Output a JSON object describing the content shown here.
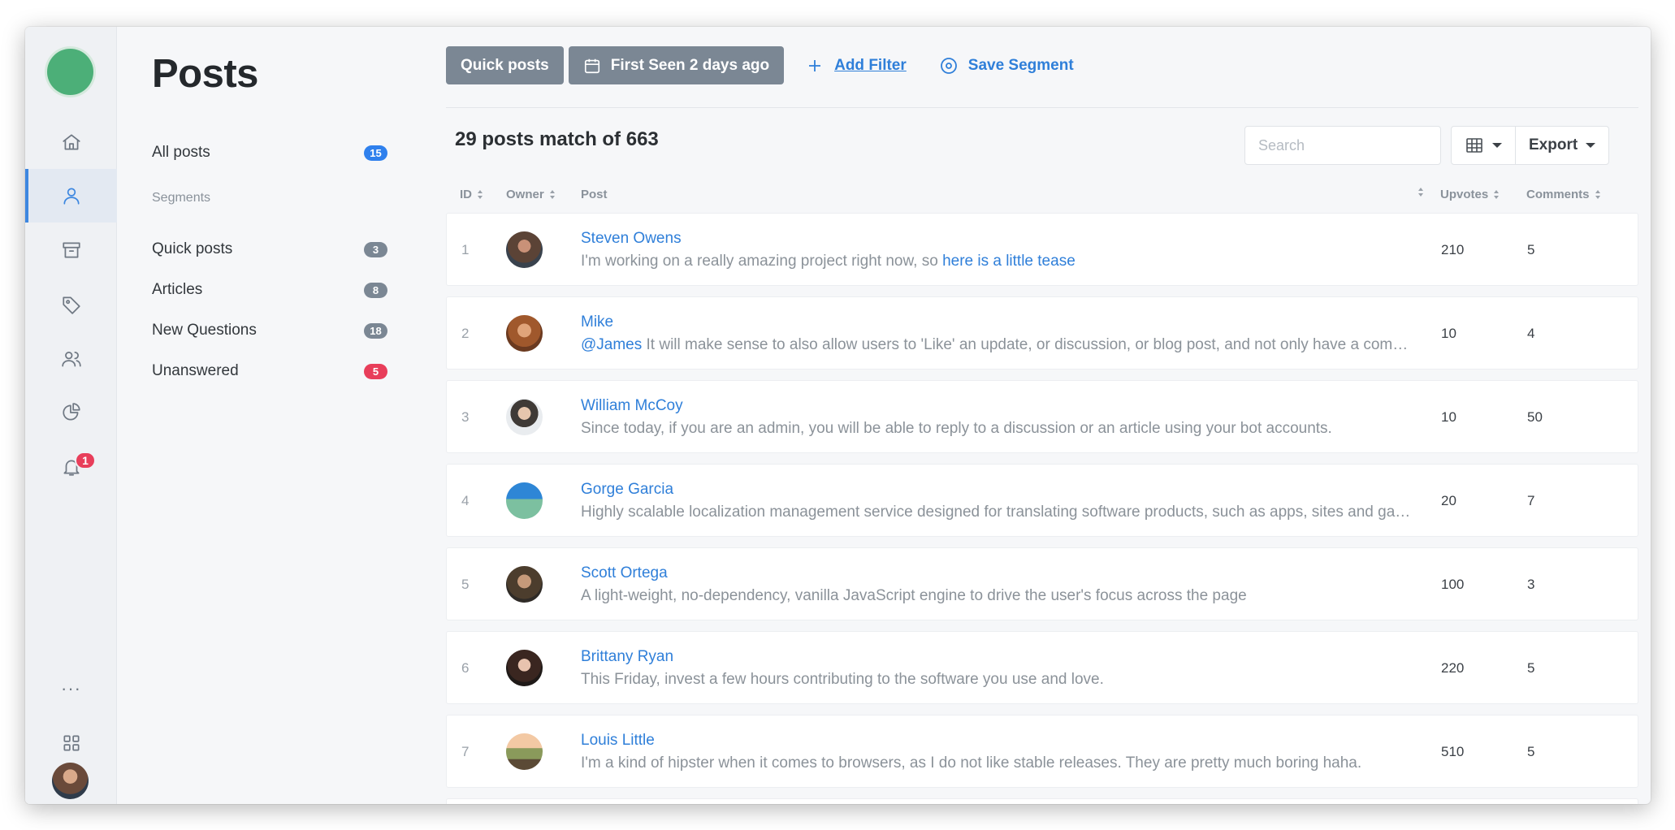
{
  "page": {
    "title": "Posts"
  },
  "segments": {
    "all": {
      "label": "All posts",
      "count": "15",
      "color": "#2f80ed"
    },
    "heading": "Segments",
    "items": [
      {
        "label": "Quick posts",
        "count": "3",
        "color": "#7b8794"
      },
      {
        "label": "Articles",
        "count": "8",
        "color": "#7b8794"
      },
      {
        "label": "New Questions",
        "count": "18",
        "color": "#7b8794"
      },
      {
        "label": "Unanswered",
        "count": "5",
        "color": "#e83e5a"
      }
    ]
  },
  "rail": {
    "notification_badge": "1",
    "more_label": "···",
    "icons": [
      "home-icon",
      "user-icon",
      "archive-icon",
      "tag-icon",
      "users-icon",
      "pie-chart-icon",
      "bell-icon",
      "apps-grid-icon"
    ]
  },
  "toolbar": {
    "filter_chip": "Quick posts",
    "date_chip": "First Seen 2 days ago",
    "add_filter": "Add Filter",
    "save_segment": "Save Segment"
  },
  "summary": {
    "text": "29 posts match of 663"
  },
  "search": {
    "placeholder": "Search"
  },
  "actions": {
    "export": "Export"
  },
  "table": {
    "columns": {
      "id": "ID",
      "owner": "Owner",
      "post": "Post",
      "upvotes": "Upvotes",
      "comments": "Comments"
    },
    "rows": [
      {
        "id": "1",
        "name": "Steven Owens",
        "excerpt": "I'm working on a really amazing project right now, so ",
        "link": "here is a little tease",
        "upvotes": "210",
        "comments": "5"
      },
      {
        "id": "2",
        "name": "Mike",
        "mention": "@James",
        "excerpt": " It will make sense to also allow users to 'Like' an update, or discussion, or blog post, and not only have a comments section",
        "upvotes": "10",
        "comments": "4"
      },
      {
        "id": "3",
        "name": "William McCoy",
        "excerpt": "Since today, if you are an admin, you will be able to reply to a discussion or an article using your bot accounts.",
        "upvotes": "10",
        "comments": "50"
      },
      {
        "id": "4",
        "name": "Gorge Garcia",
        "excerpt": "Highly scalable localization management service designed for translating software products, such as apps, sites and games",
        "upvotes": "20",
        "comments": "7"
      },
      {
        "id": "5",
        "name": "Scott Ortega",
        "excerpt": "A light-weight, no-dependency, vanilla JavaScript engine to drive the user's focus across the page",
        "upvotes": "100",
        "comments": "3"
      },
      {
        "id": "6",
        "name": "Brittany Ryan",
        "excerpt": "This Friday, invest a few hours contributing to the software you use and love.",
        "upvotes": "220",
        "comments": "5"
      },
      {
        "id": "7",
        "name": "Louis Little",
        "excerpt": "I'm a kind of hipster when it comes to browsers, as I do not like stable releases. They are pretty much boring haha.",
        "upvotes": "510",
        "comments": "5"
      }
    ]
  },
  "colors": {
    "accent": "#2f7fd9",
    "chip": "#7b8794",
    "danger": "#e83e5a",
    "logo": "#4caf78"
  }
}
